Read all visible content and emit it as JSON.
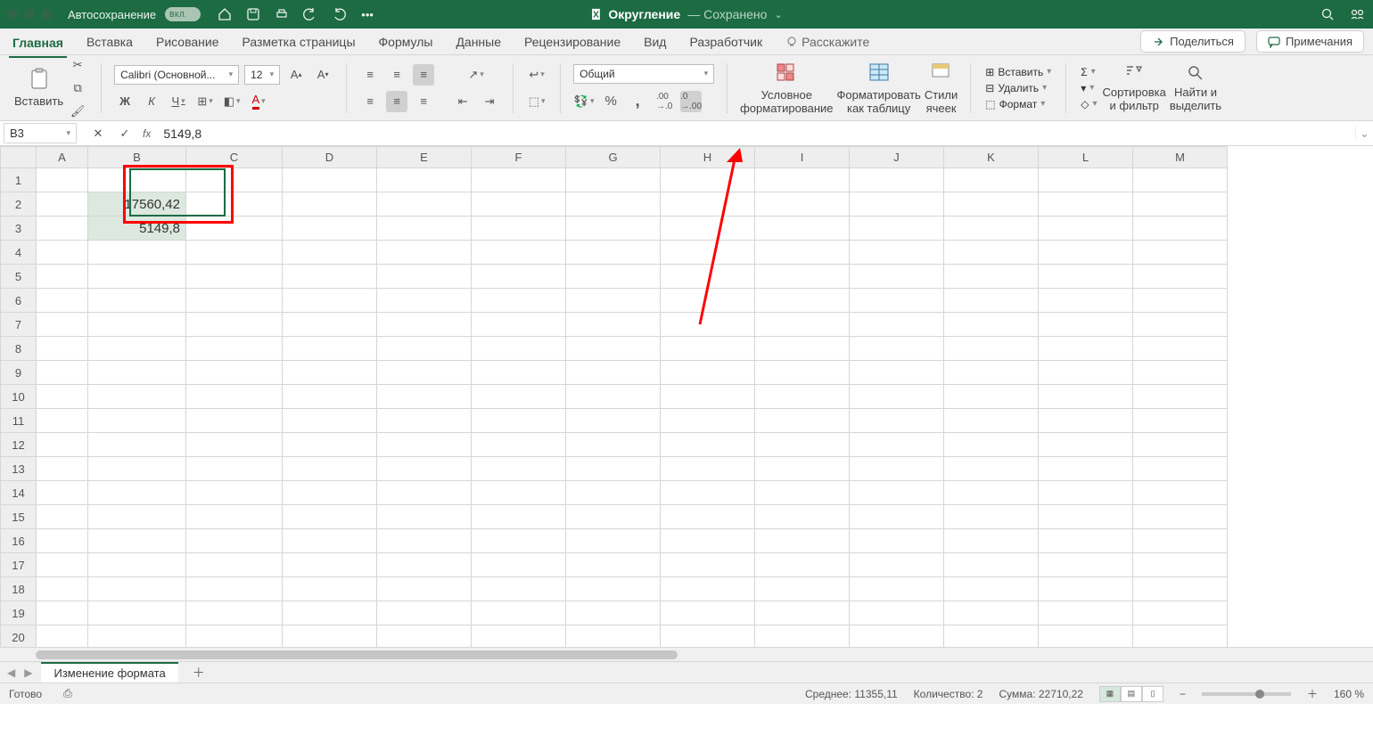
{
  "titlebar": {
    "autosave_label": "Автосохранение",
    "autosave_toggle": "ВКЛ.",
    "doc_name": "Округление",
    "saved_label": "— Сохранено"
  },
  "tabs": {
    "home": "Главная",
    "insert": "Вставка",
    "draw": "Рисование",
    "layout": "Разметка страницы",
    "formulas": "Формулы",
    "data": "Данные",
    "review": "Рецензирование",
    "view": "Вид",
    "developer": "Разработчик",
    "tellme": "Расскажите",
    "share": "Поделиться",
    "comments": "Примечания"
  },
  "ribbon": {
    "paste": "Вставить",
    "font_name": "Calibri (Основной...",
    "font_size": "12",
    "bold": "Ж",
    "italic": "К",
    "underline": "Ч",
    "number_format": "Общий",
    "cond_format": "Условное\nформатирование",
    "as_table": "Форматировать\nкак таблицу",
    "cell_styles": "Стили\nячеек",
    "cells_insert": "Вставить",
    "cells_delete": "Удалить",
    "cells_format": "Формат",
    "sort_filter": "Сортировка\nи фильтр",
    "find_select": "Найти и\nвыделить"
  },
  "formula_bar": {
    "namebox": "B3",
    "fx_label": "fx",
    "value": "5149,8"
  },
  "grid": {
    "columns": [
      "A",
      "B",
      "C",
      "D",
      "E",
      "F",
      "G",
      "H",
      "I",
      "J",
      "K",
      "L",
      "M"
    ],
    "rows": 20,
    "cells": {
      "B2": "17560,42",
      "B3": "5149,8"
    }
  },
  "sheet": {
    "name": "Изменение формата"
  },
  "status": {
    "ready": "Готово",
    "avg_label": "Среднее:",
    "avg_val": "11355,11",
    "count_label": "Количество:",
    "count_val": "2",
    "sum_label": "Сумма:",
    "sum_val": "22710,22",
    "zoom": "160 %"
  }
}
